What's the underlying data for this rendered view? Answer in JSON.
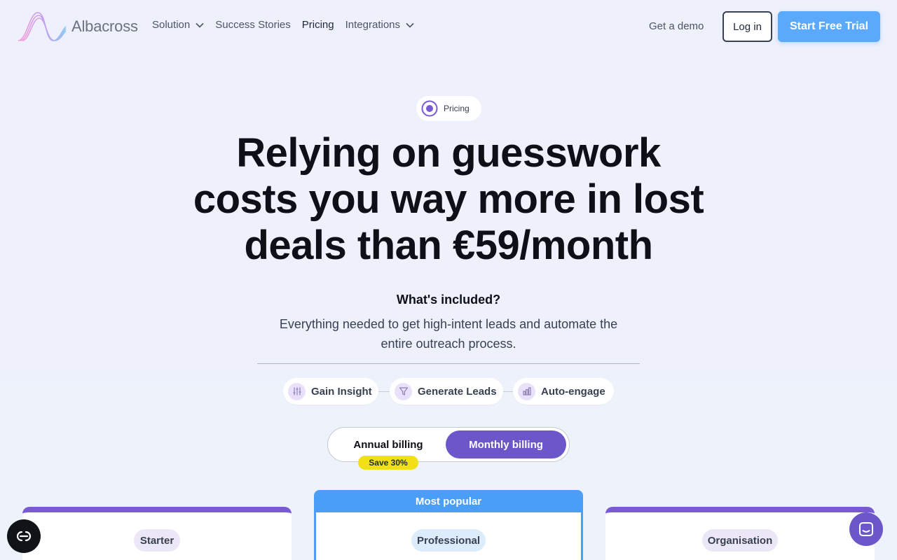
{
  "brand": {
    "name": "Albacross",
    "logo_icon": "albacross-wave-logo"
  },
  "nav": {
    "items": [
      {
        "label": "Solution",
        "has_dropdown": true
      },
      {
        "label": "Success Stories",
        "has_dropdown": false
      },
      {
        "label": "Pricing",
        "has_dropdown": false,
        "active": true
      },
      {
        "label": "Integrations",
        "has_dropdown": true
      }
    ],
    "demo_label": "Get a demo",
    "login_label": "Log in",
    "trial_label": "Start Free Trial"
  },
  "hero": {
    "pill_label": "Pricing",
    "headline_line1": "Relying on guesswork",
    "headline_line2": "costs you way more in lost",
    "headline_line3": "deals than €59/month",
    "included_title": "What's included?",
    "subcopy": "Everything needed to get high-intent leads and automate the entire outreach process."
  },
  "features": [
    {
      "label": "Gain Insight",
      "icon": "sliders-icon"
    },
    {
      "label": "Generate Leads",
      "icon": "filter-icon"
    },
    {
      "label": "Auto-engage",
      "icon": "bar-chart-icon"
    }
  ],
  "billing": {
    "annual_label": "Annual billing",
    "monthly_label": "Monthly billing",
    "selected": "monthly",
    "save_badge": "Save 30%"
  },
  "plans": [
    {
      "name": "Starter"
    },
    {
      "name": "Professional",
      "banner": "Most popular"
    },
    {
      "name": "Organisation"
    }
  ],
  "colors": {
    "accent_purple": "#6b57c9",
    "accent_blue": "#5aa9fb",
    "badge_yellow": "#f1e016"
  }
}
